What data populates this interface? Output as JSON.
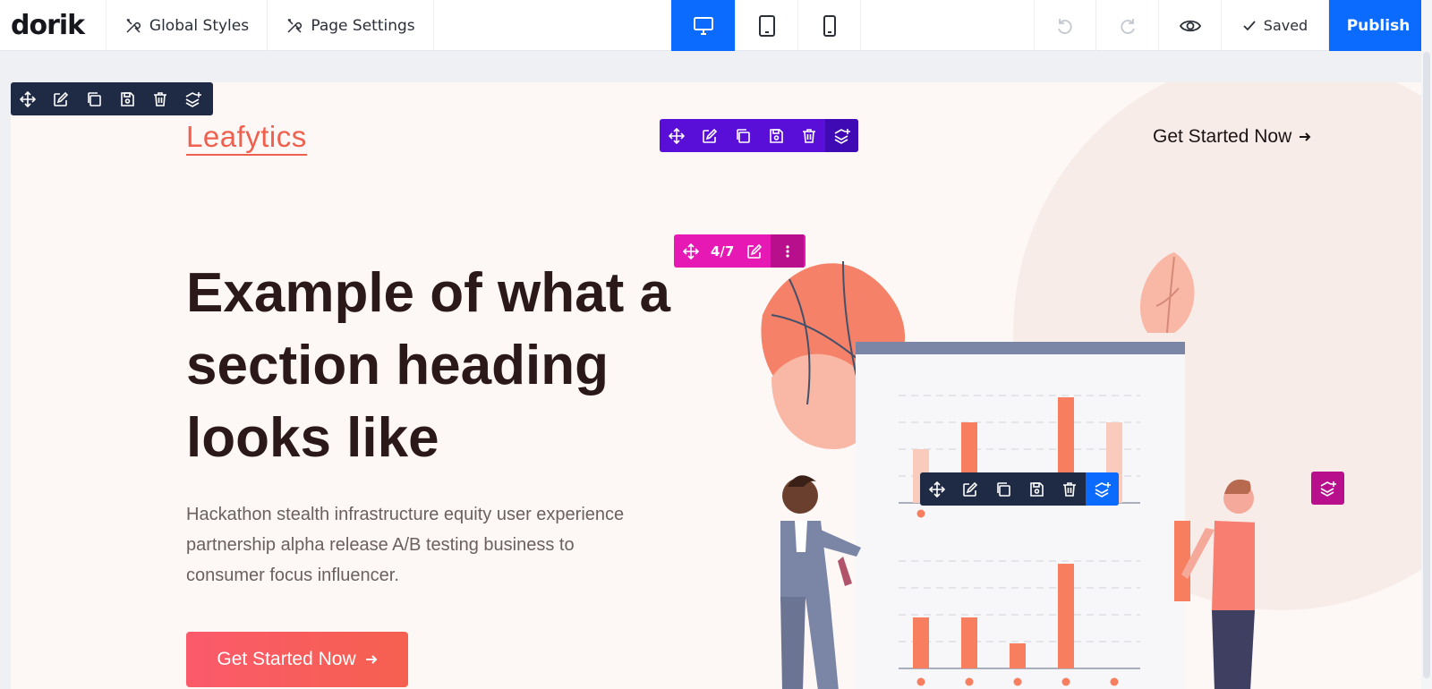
{
  "app": {
    "logo": "dorik",
    "menu": {
      "global_styles": "Global Styles",
      "page_settings": "Page Settings"
    },
    "devices": [
      "desktop-icon",
      "tablet-icon",
      "mobile-icon"
    ],
    "active_device": "desktop",
    "status": "Saved",
    "publish": "Publish",
    "colors": {
      "primary": "#0b6bff",
      "section_toolbar": "#1f2a44",
      "row_toolbar": "#5a0fd9",
      "column_toolbar": "#e619b4",
      "accent": "#f0604f"
    }
  },
  "toolbars": {
    "icons": [
      "move-icon",
      "edit-icon",
      "duplicate-icon",
      "save-icon",
      "delete-icon",
      "add-layer-icon"
    ],
    "column_label": "4/7"
  },
  "page": {
    "brand": "Leafytics",
    "nav_cta": "Get Started Now",
    "heading_lines": [
      "Example of what a",
      "section heading",
      "looks like"
    ],
    "paragraph_lines": [
      "Hackathon stealth infrastructure equity user experience",
      "partnership alpha release A/B testing business to",
      "consumer focus influencer."
    ],
    "cta": "Get Started Now"
  }
}
